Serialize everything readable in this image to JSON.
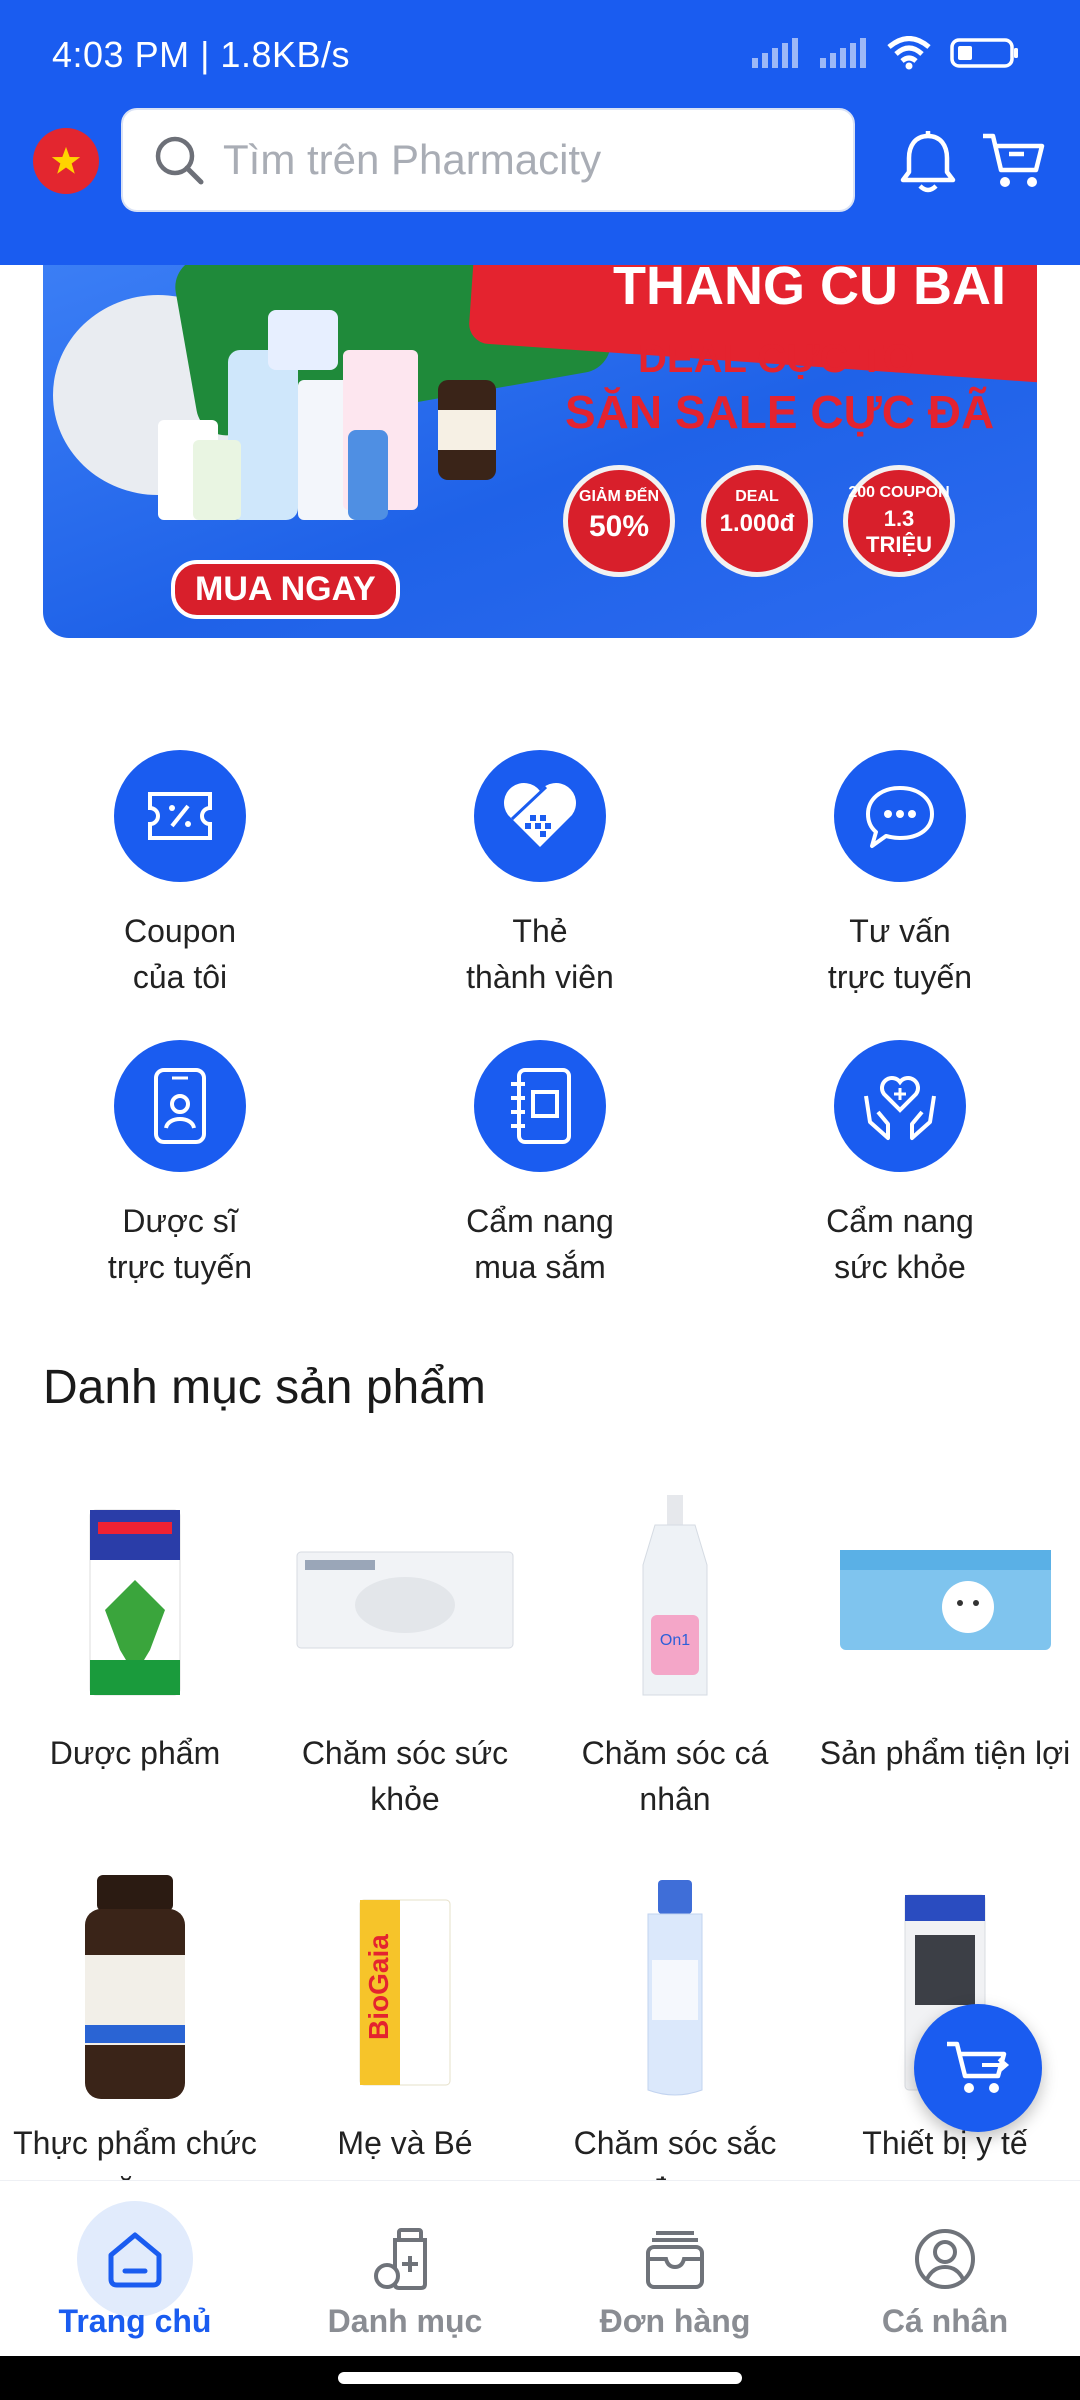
{
  "status_bar": {
    "time": "4:03 PM | 1.8KB/s"
  },
  "header": {
    "search_placeholder": "Tìm trên Pharmacity"
  },
  "banner": {
    "headline": "THÁNG CỦ BÀI",
    "line1": "DEAL CỰC TO",
    "line2": "SĂN SALE CỰC ĐÃ",
    "badges": [
      {
        "small": "GIẢM ĐẾN",
        "big": "50%"
      },
      {
        "small": "DEAL",
        "big": "1.000đ"
      },
      {
        "small": "200 COUPON",
        "big": "1.3 TRIỆU"
      }
    ],
    "cta": "MUA NGAY"
  },
  "quick_actions": [
    {
      "label": "Coupon\ncủa tôi",
      "icon": "coupon-icon"
    },
    {
      "label": "Thẻ\nthành viên",
      "icon": "member-card-icon"
    },
    {
      "label": "Tư vấn\ntrực tuyến",
      "icon": "chat-icon"
    },
    {
      "label": "Dược sĩ\ntrực tuyến",
      "icon": "pharmacist-phone-icon"
    },
    {
      "label": "Cẩm nang\nmua sắm",
      "icon": "notebook-icon"
    },
    {
      "label": "Cẩm nang\nsức khỏe",
      "icon": "health-hands-icon"
    }
  ],
  "category_section": {
    "title": "Danh mục sản phẩm",
    "items": [
      {
        "label": "Dược phẩm"
      },
      {
        "label": "Chăm sóc sức khỏe"
      },
      {
        "label": "Chăm sóc cá nhân"
      },
      {
        "label": "Sản phẩm tiện lợi"
      },
      {
        "label": "Thực phẩm chức năng"
      },
      {
        "label": "Mẹ và Bé"
      },
      {
        "label": "Chăm sóc sắc đẹp"
      },
      {
        "label": "Thiết bị y tế"
      }
    ]
  },
  "bottom_nav": [
    {
      "label": "Trang chủ",
      "active": true,
      "icon": "home-icon"
    },
    {
      "label": "Danh mục",
      "active": false,
      "icon": "medicine-bottle-icon"
    },
    {
      "label": "Đơn hàng",
      "active": false,
      "icon": "orders-box-icon"
    },
    {
      "label": "Cá nhân",
      "active": false,
      "icon": "user-icon"
    }
  ],
  "colors": {
    "primary": "#1a5cf0",
    "banner_red": "#e4232f",
    "active_nav_bg": "#e1ebfc"
  }
}
